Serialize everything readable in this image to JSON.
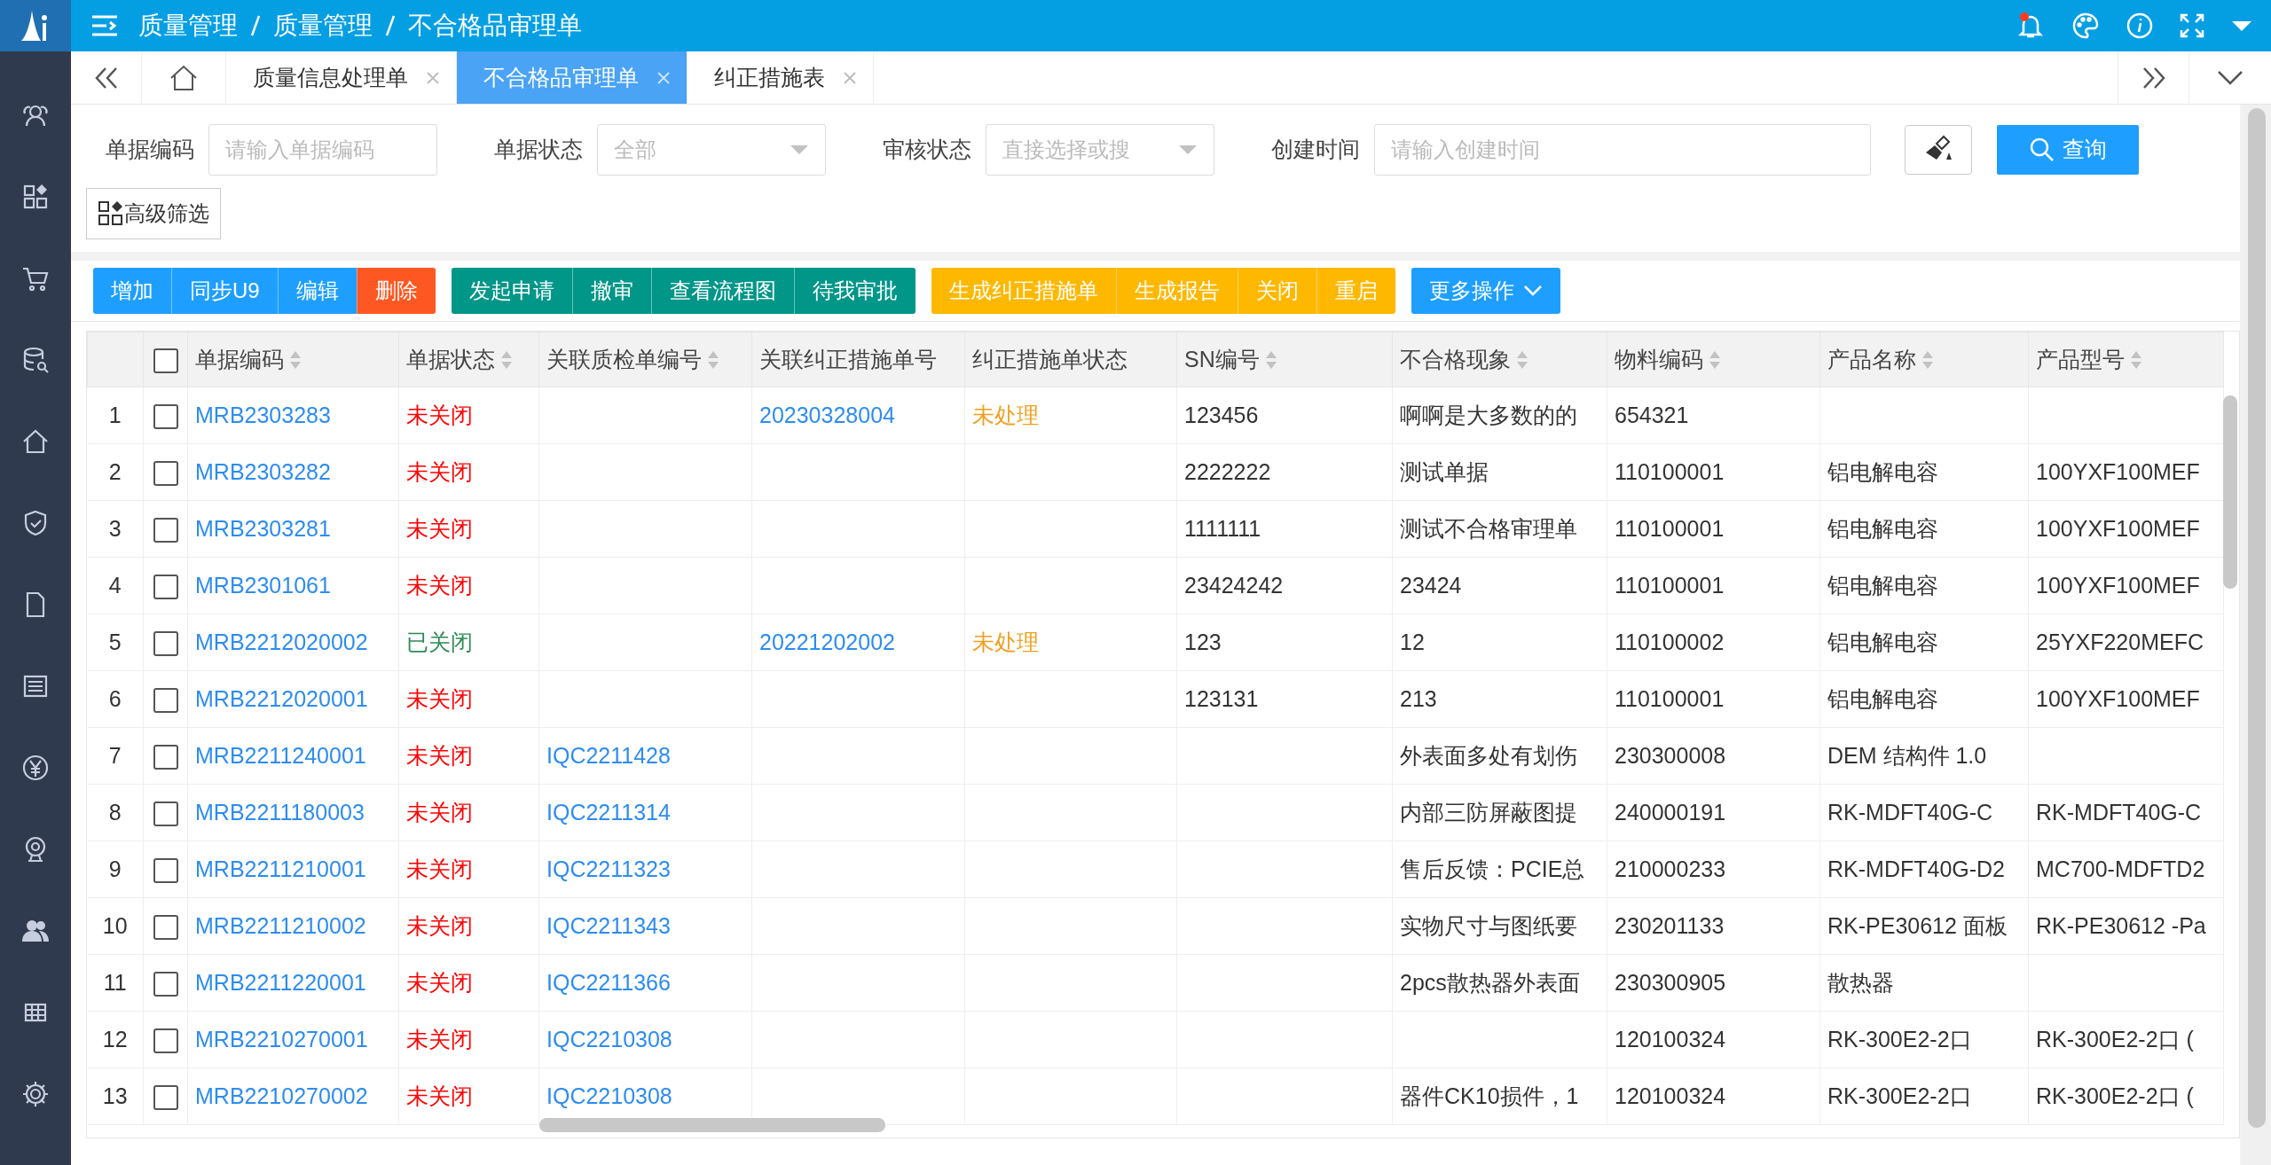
{
  "breadcrumb": [
    "质量管理",
    "质量管理",
    "不合格品审理单"
  ],
  "tabs": [
    {
      "label": "质量信息处理单",
      "selected": false
    },
    {
      "label": "不合格品审理单",
      "selected": true
    },
    {
      "label": "纠正措施表",
      "selected": false
    }
  ],
  "filters": [
    {
      "label": "单据编码",
      "kind": "text",
      "placeholder": "请输入单据编码"
    },
    {
      "label": "单据状态",
      "kind": "select",
      "placeholder": "全部"
    },
    {
      "label": "审核状态",
      "kind": "select",
      "placeholder": "直接选择或搜"
    },
    {
      "label": "创建时间",
      "kind": "text",
      "placeholder": "请输入创建时间"
    }
  ],
  "search_button": "查询",
  "advanced_filter": "高级筛选",
  "toolbar": [
    [
      {
        "label": "增加",
        "color": "#1e9fff"
      },
      {
        "label": "同步U9",
        "color": "#1e9fff"
      },
      {
        "label": "编辑",
        "color": "#1e9fff"
      },
      {
        "label": "删除",
        "color": "#ff5722"
      }
    ],
    [
      {
        "label": "发起申请",
        "color": "#009688"
      },
      {
        "label": "撤审",
        "color": "#009688"
      },
      {
        "label": "查看流程图",
        "color": "#009688"
      },
      {
        "label": "待我审批",
        "color": "#009688"
      }
    ],
    [
      {
        "label": "生成纠正措施单",
        "color": "#ffb800"
      },
      {
        "label": "生成报告",
        "color": "#ffb800"
      },
      {
        "label": "关闭",
        "color": "#ffb800"
      },
      {
        "label": "重启",
        "color": "#ffb800"
      }
    ],
    [
      {
        "label": "更多操作",
        "color": "#1e9fff",
        "dropdown": true
      }
    ]
  ],
  "table": {
    "header_checked": false,
    "columns": [
      {
        "label": "单据编码",
        "sortable": true,
        "kind": "link"
      },
      {
        "label": "单据状态",
        "sortable": true,
        "kind": "state"
      },
      {
        "label": "关联质检单编号",
        "sortable": true,
        "kind": "link"
      },
      {
        "label": "关联纠正措施单号",
        "sortable": false,
        "kind": "link"
      },
      {
        "label": "纠正措施单状态",
        "sortable": false,
        "kind": "pending"
      },
      {
        "label": "SN编号",
        "sortable": true,
        "kind": "text"
      },
      {
        "label": "不合格现象",
        "sortable": true,
        "kind": "text"
      },
      {
        "label": "物料编码",
        "sortable": true,
        "kind": "text"
      },
      {
        "label": "产品名称",
        "sortable": true,
        "kind": "text"
      },
      {
        "label": "产品型号",
        "sortable": true,
        "kind": "text"
      }
    ],
    "rows": [
      {
        "no": "1",
        "checked": false,
        "closed": false,
        "cells": [
          "MRB2303283",
          "未关闭",
          null,
          "20230328004",
          "未处理",
          "123456",
          "啊啊是大多数的的",
          "654321",
          null,
          null
        ]
      },
      {
        "no": "2",
        "checked": false,
        "closed": false,
        "cells": [
          "MRB2303282",
          "未关闭",
          null,
          null,
          null,
          "2222222",
          "测试单据",
          "110100001",
          "铝电解电容",
          "100YXF100MEF"
        ]
      },
      {
        "no": "3",
        "checked": false,
        "closed": false,
        "cells": [
          "MRB2303281",
          "未关闭",
          null,
          null,
          null,
          "1111111",
          "测试不合格审理单",
          "110100001",
          "铝电解电容",
          "100YXF100MEF"
        ]
      },
      {
        "no": "4",
        "checked": false,
        "closed": false,
        "cells": [
          "MRB2301061",
          "未关闭",
          null,
          null,
          null,
          "23424242",
          "23424",
          "110100001",
          "铝电解电容",
          "100YXF100MEF"
        ]
      },
      {
        "no": "5",
        "checked": false,
        "closed": true,
        "cells": [
          "MRB2212020002",
          "已关闭",
          null,
          "20221202002",
          "未处理",
          "123",
          "12",
          "110100002",
          "铝电解电容",
          "25YXF220MEFC"
        ]
      },
      {
        "no": "6",
        "checked": false,
        "closed": false,
        "cells": [
          "MRB2212020001",
          "未关闭",
          null,
          null,
          null,
          "123131",
          "213",
          "110100001",
          "铝电解电容",
          "100YXF100MEF"
        ]
      },
      {
        "no": "7",
        "checked": false,
        "closed": false,
        "cells": [
          "MRB2211240001",
          "未关闭",
          "IQC2211428",
          null,
          null,
          null,
          "外表面多处有划伤",
          "230300008",
          "DEM 结构件 1.0",
          null
        ]
      },
      {
        "no": "8",
        "checked": false,
        "closed": false,
        "cells": [
          "MRB2211180003",
          "未关闭",
          "IQC2211314",
          null,
          null,
          null,
          "内部三防屏蔽图提",
          "240000191",
          "RK-MDFT40G-C",
          "RK-MDFT40G-C"
        ]
      },
      {
        "no": "9",
        "checked": false,
        "closed": false,
        "cells": [
          "MRB2211210001",
          "未关闭",
          "IQC2211323",
          null,
          null,
          null,
          "售后反馈：PCIE总",
          "210000233",
          "RK-MDFT40G-D2",
          "MC700-MDFTD2"
        ]
      },
      {
        "no": "10",
        "checked": false,
        "closed": false,
        "cells": [
          "MRB2211210002",
          "未关闭",
          "IQC2211343",
          null,
          null,
          null,
          "实物尺寸与图纸要",
          "230201133",
          "RK-PE30612 面板",
          "RK-PE30612 -Pa"
        ]
      },
      {
        "no": "11",
        "checked": false,
        "closed": false,
        "cells": [
          "MRB2211220001",
          "未关闭",
          "IQC2211366",
          null,
          null,
          null,
          "2pcs散热器外表面",
          "230300905",
          "散热器",
          null
        ]
      },
      {
        "no": "12",
        "checked": false,
        "closed": false,
        "cells": [
          "MRB2210270001",
          "未关闭",
          "IQC2210308",
          null,
          null,
          null,
          null,
          "120100324",
          "RK-300E2-2口",
          "RK-300E2-2口 ("
        ]
      },
      {
        "no": "13",
        "checked": false,
        "closed": false,
        "cells": [
          "MRB2210270002",
          "未关闭",
          "IQC2210308",
          null,
          null,
          null,
          "器件CK10损件，1",
          "120100324",
          "RK-300E2-2口",
          "RK-300E2-2口 ("
        ]
      }
    ]
  }
}
